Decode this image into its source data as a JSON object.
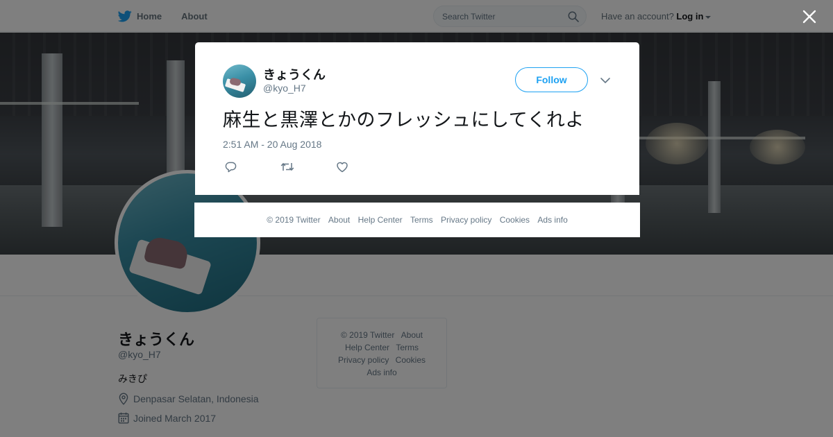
{
  "nav": {
    "home_label": "Home",
    "about_label": "About",
    "search_placeholder": "Search Twitter",
    "account_prompt": "Have an account?",
    "login_label": "Log in"
  },
  "profile": {
    "name": "きょうくん",
    "handle": "@kyo_H7",
    "bio": "みきぴ",
    "location": "Denpasar Selatan, Indonesia",
    "joined": "Joined March 2017"
  },
  "side_footer": {
    "copyright": "© 2019 Twitter",
    "about": "About",
    "help_center": "Help Center",
    "terms": "Terms",
    "privacy": "Privacy policy",
    "cookies": "Cookies",
    "ads_info": "Ads info"
  },
  "tweet": {
    "author_name": "きょうくん",
    "author_handle": "@kyo_H7",
    "follow_label": "Follow",
    "text": "麻生と黒澤とかのフレッシュにしてくれよ",
    "timestamp": "2:51 AM - 20 Aug 2018"
  },
  "modal_footer": {
    "copyright": "© 2019 Twitter",
    "about": "About",
    "help_center": "Help Center",
    "terms": "Terms",
    "privacy": "Privacy policy",
    "cookies": "Cookies",
    "ads_info": "Ads info"
  },
  "icons": {
    "logo": "twitter-bird-icon",
    "search": "search-icon",
    "close": "close-icon",
    "more": "chevron-down-icon",
    "reply": "reply-icon",
    "retweet": "retweet-icon",
    "like": "heart-icon",
    "location": "location-pin-icon",
    "calendar": "calendar-icon"
  },
  "colors": {
    "brand": "#1da1f2",
    "overlay": "rgba(0,0,0,0.5)",
    "secondary_text": "#657786"
  }
}
